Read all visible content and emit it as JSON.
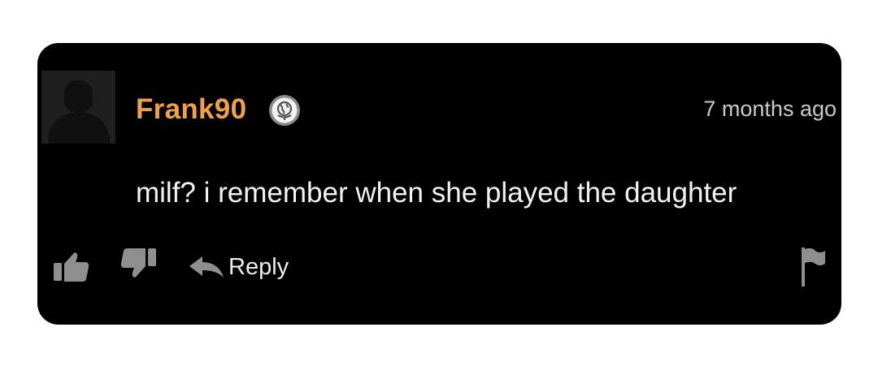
{
  "comment": {
    "username": "Frank90",
    "timestamp": "7 months ago",
    "text": "milf? i remember when she played the daughter",
    "badge_icon": "globe-icon",
    "avatar_icon": "default-avatar-icon"
  },
  "actions": {
    "like_icon": "thumbs-up-icon",
    "dislike_icon": "thumbs-down-icon",
    "reply_icon": "reply-arrow-icon",
    "reply_label": "Reply",
    "flag_icon": "flag-icon"
  },
  "colors": {
    "card_background": "#000000",
    "username": "#f0a04b",
    "body_text": "#f2f2f2",
    "icon_gray": "#8f8f8f"
  }
}
